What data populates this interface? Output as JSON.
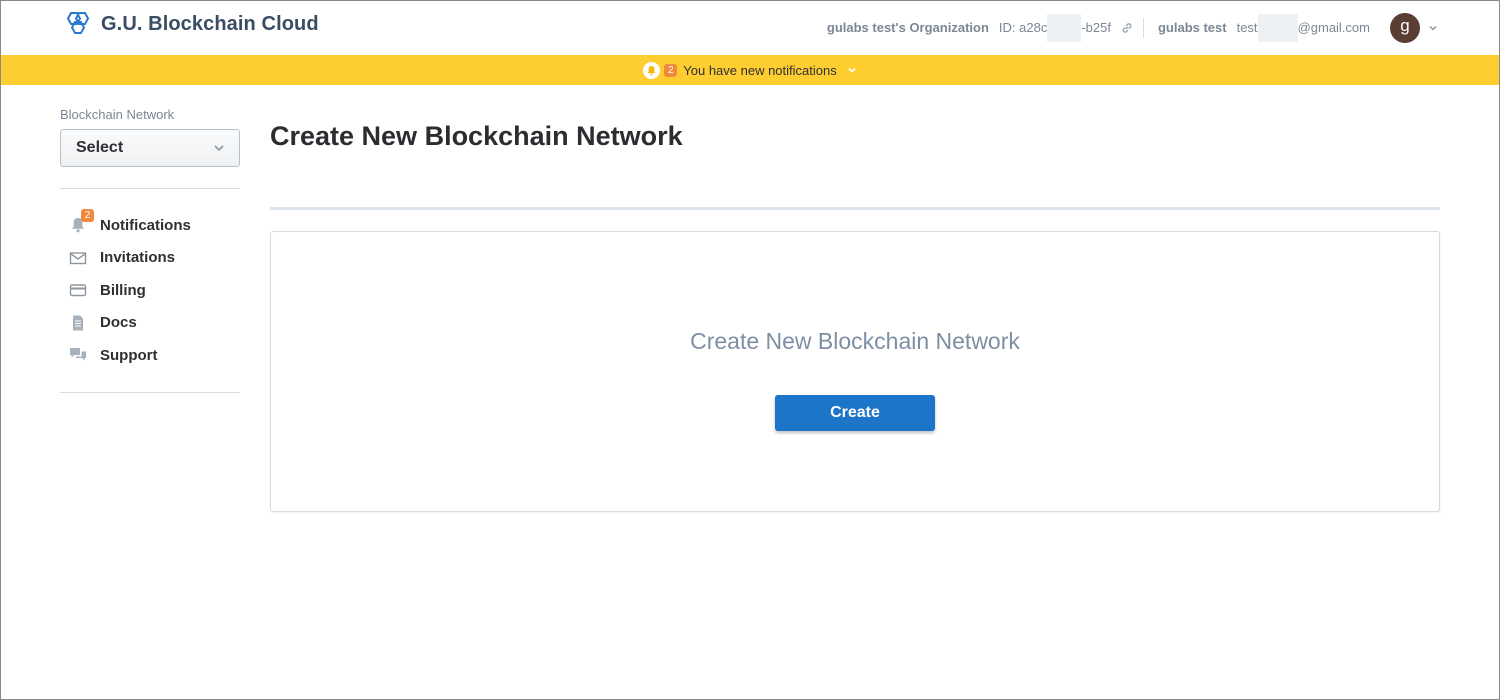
{
  "header": {
    "brand_name": "G.U. Blockchain Cloud",
    "org_name": "gulabs test's Organization",
    "org_id_prefix": "ID: a28c",
    "org_id_suffix": "-b25f",
    "user_name": "gulabs test",
    "user_email_prefix": "test",
    "user_email_suffix": "@gmail.com",
    "avatar_letter": "g"
  },
  "banner": {
    "badge_count": "2",
    "message": "You have new notifications"
  },
  "sidebar": {
    "network_label": "Blockchain Network",
    "select_value": "Select",
    "items": [
      {
        "label": "Notifications",
        "icon": "bell-icon",
        "badge": "2"
      },
      {
        "label": "Invitations",
        "icon": "envelope-icon"
      },
      {
        "label": "Billing",
        "icon": "credit-card-icon"
      },
      {
        "label": "Docs",
        "icon": "document-icon"
      },
      {
        "label": "Support",
        "icon": "chat-icon"
      }
    ]
  },
  "main": {
    "page_title": "Create New Blockchain Network",
    "card_title": "Create New Blockchain Network",
    "create_button": "Create"
  },
  "colors": {
    "banner": "#fecd2f",
    "badge": "#f0893b",
    "primary_button": "#1c75c8",
    "brand": "#3a4d63"
  }
}
